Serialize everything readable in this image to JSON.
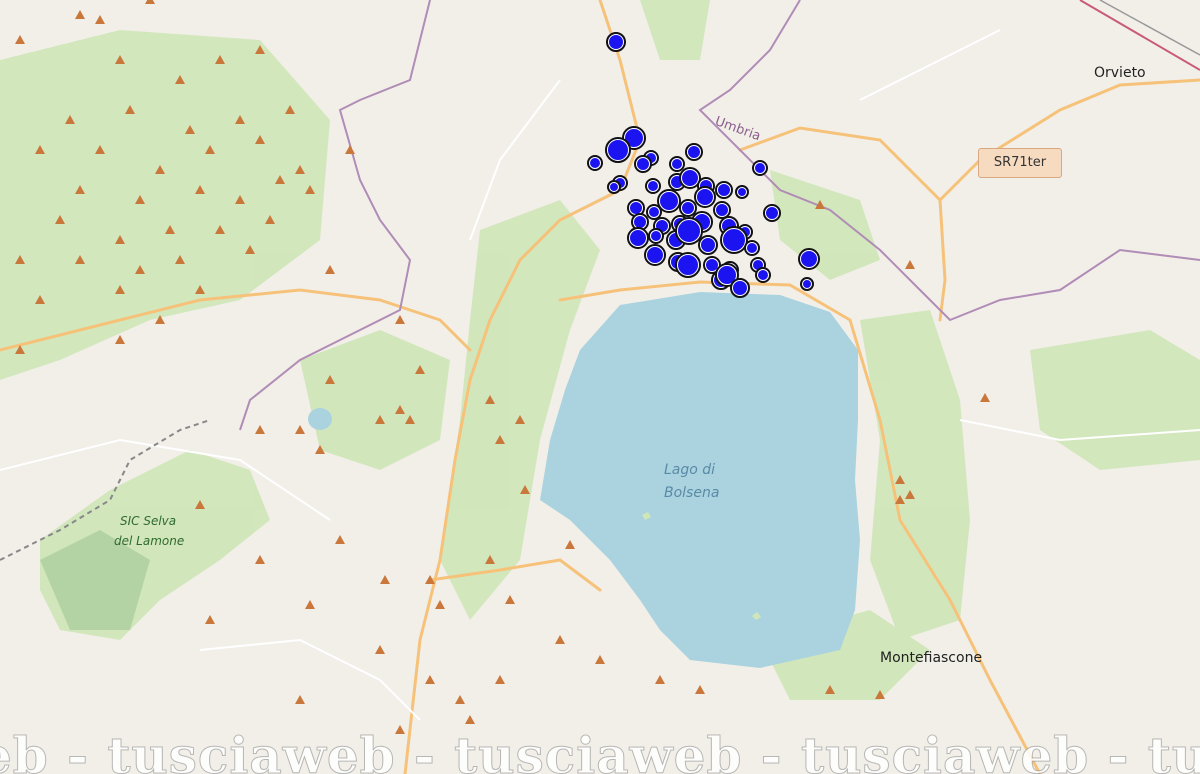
{
  "map": {
    "labels": {
      "orvieto": "Orvieto",
      "montefiascone": "Montefiascone",
      "lake_line1": "Lago di",
      "lake_line2": "Bolsena",
      "umbria": "Umbria",
      "sic_line1": "SIC Selva",
      "sic_line2": "del Lamone",
      "road_badge": "SR71ter"
    },
    "watermark": "eb - tusciaweb - tusciaweb - tusciaweb - tusciaweb - tuscia",
    "colors": {
      "background": "#f2efe9",
      "water": "#aad3df",
      "forest": "#c8e3b0",
      "road": "#f8c984",
      "marker_fill": "#1c14f0",
      "marker_stroke": "#ffffff",
      "peak": "#c9773b"
    },
    "icons": {
      "peak": "peak-triangle-icon",
      "earthquake": "earthquake-marker-icon"
    }
  }
}
